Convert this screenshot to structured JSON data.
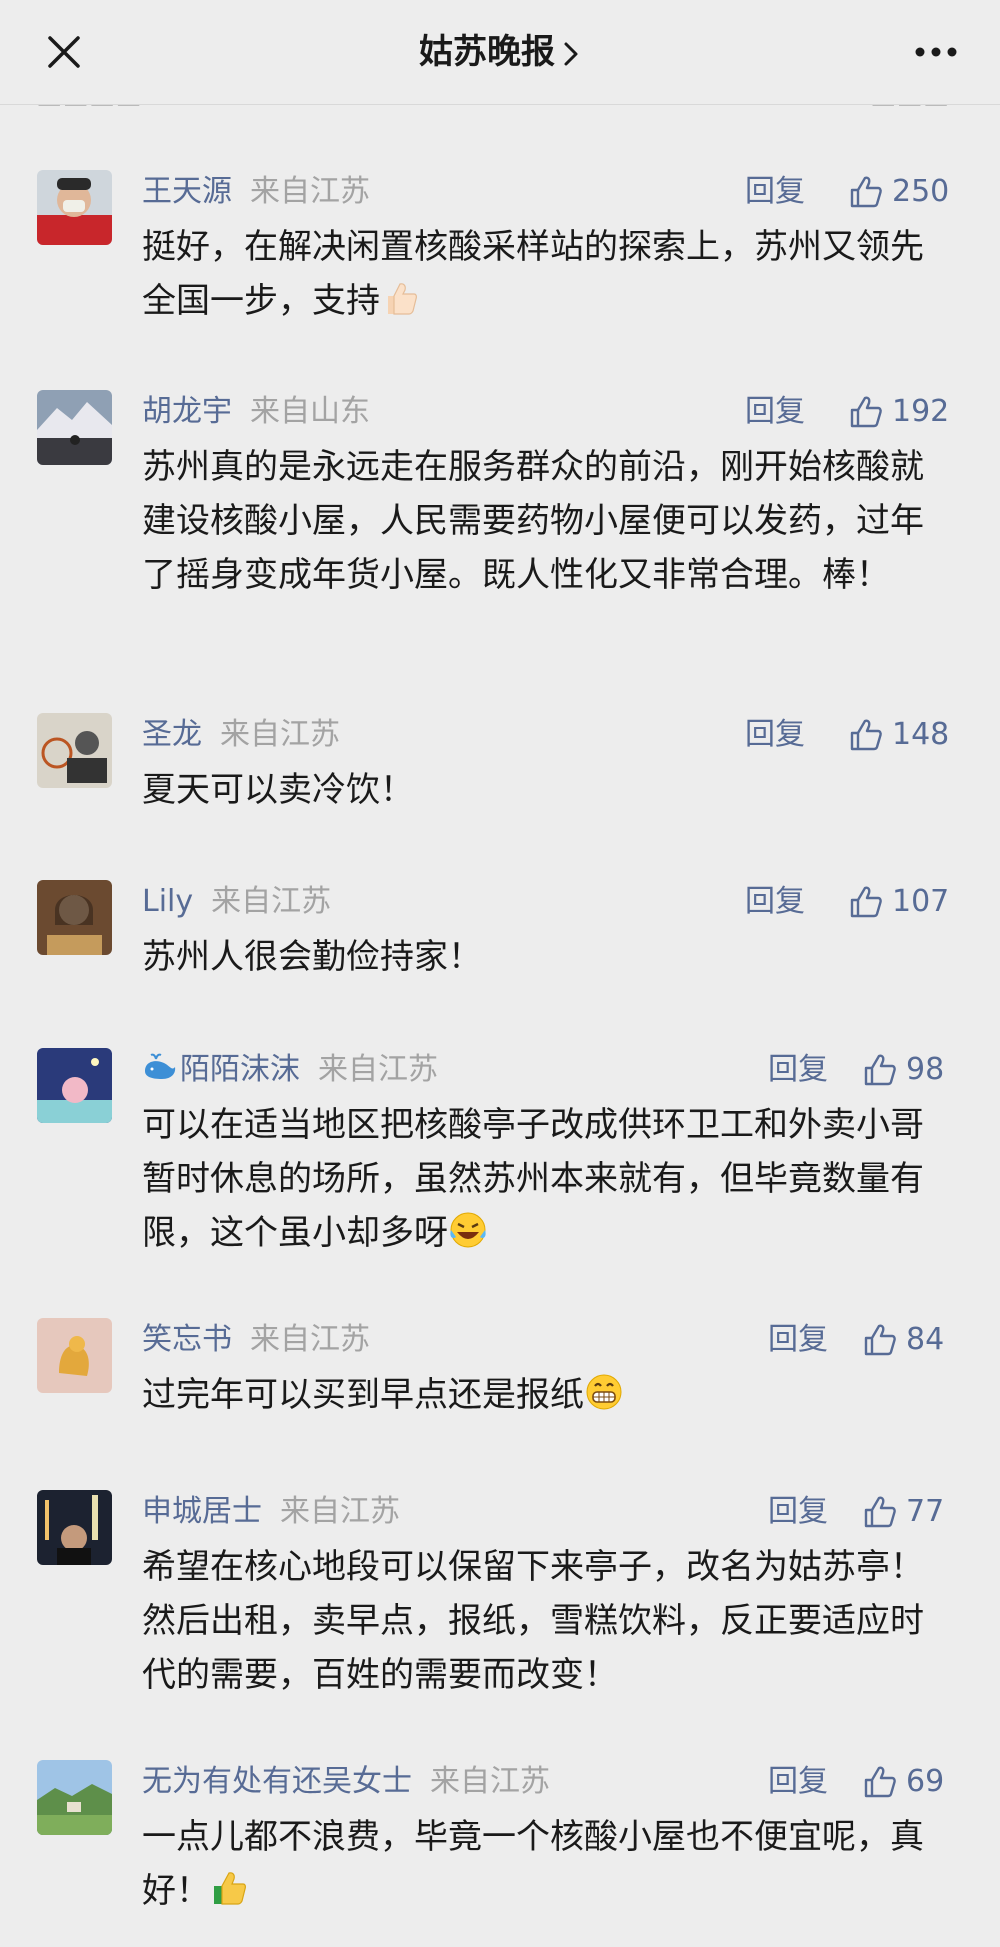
{
  "header": {
    "title": "姑苏晚报",
    "chevron_icon": "chevron-right-icon",
    "close_icon": "close-icon",
    "more_icon": "more-dots-icon"
  },
  "comments": [
    {
      "user": "王天源",
      "region": "来自江苏",
      "reply": "回复",
      "likes": "250",
      "text": "挺好，在解决闲置核酸采样站的探索上，苏州又领先全国一步，支持",
      "emoji": "thumbs-up-emoji"
    },
    {
      "user": "胡龙宇",
      "region": "来自山东",
      "reply": "回复",
      "likes": "192",
      "text": "苏州真的是永远走在服务群众的前沿，刚开始核酸就建设核酸小屋，人民需要药物小屋便可以发药，过年了摇身变成年货小屋。既人性化又非常合理。棒！"
    },
    {
      "user": "圣龙",
      "region": "来自江苏",
      "reply": "回复",
      "likes": "148",
      "text": "夏天可以卖冷饮！"
    },
    {
      "user": "Lily",
      "region": "来自江苏",
      "reply": "回复",
      "likes": "107",
      "text": "苏州人很会勤俭持家！"
    },
    {
      "user": "陌陌沫沫",
      "region": "来自江苏",
      "reply": "回复",
      "likes": "98",
      "user_icon": "whale-icon",
      "text": "可以在适当地区把核酸亭子改成供环卫工和外卖小哥暂时休息的场所，虽然苏州本来就有，但毕竟数量有限，这个虽小却多呀",
      "emoji": "laugh-cry-emoji"
    },
    {
      "user": "笑忘书",
      "region": "来自江苏",
      "reply": "回复",
      "likes": "84",
      "text": "过完年可以买到早点还是报纸",
      "emoji": "grin-emoji"
    },
    {
      "user": "申城居士",
      "region": "来自江苏",
      "reply": "回复",
      "likes": "77",
      "text": "希望在核心地段可以保留下来亭子，改名为姑苏亭！然后出租，卖早点，报纸，雪糕饮料，反正要适应时代的需要，百姓的需要而改变！"
    },
    {
      "user": "无为有处有还吴女士",
      "region": "来自江苏",
      "reply": "回复",
      "likes": "69",
      "text": "一点儿都不浪费，毕竟一个核酸小屋也不便宜呢，真好！",
      "emoji": "green-thumbs-up-emoji"
    }
  ]
}
